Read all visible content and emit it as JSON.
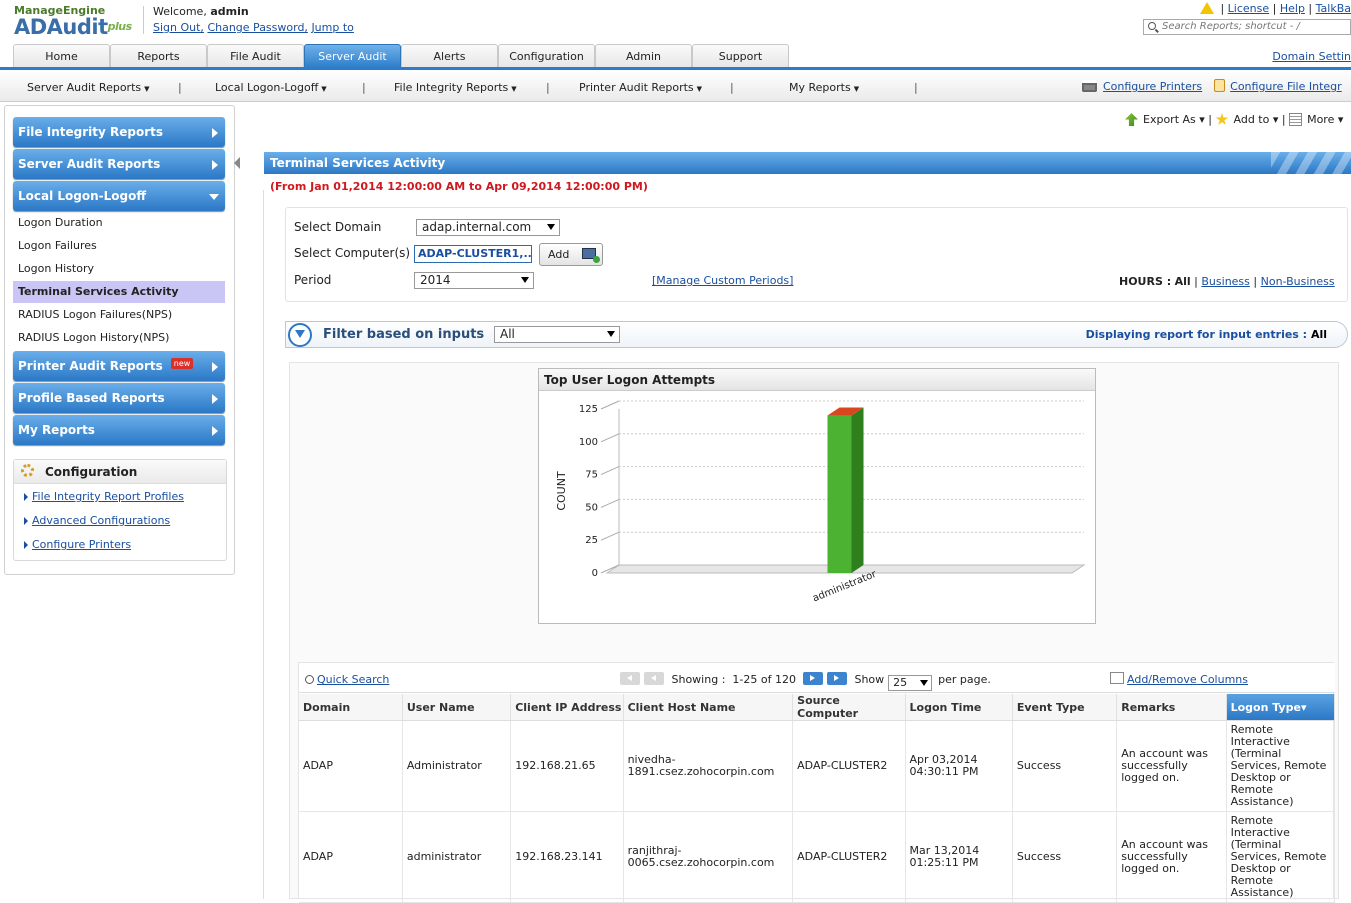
{
  "brand": {
    "manage_engine": "ManageEngine",
    "product": "ADAudit",
    "plus": "plus"
  },
  "header": {
    "welcome": "Welcome,",
    "user": "admin",
    "sign_out": "Sign Out,",
    "change_password": "Change Password,",
    "jump_to": "Jump to",
    "license": "License",
    "help": "Help",
    "talkback": "TalkBa",
    "search_placeholder": "Search Reports; shortcut - /",
    "domain_settings": "Domain Settin"
  },
  "tabs": [
    "Home",
    "Reports",
    "File Audit",
    "Server Audit",
    "Alerts",
    "Configuration",
    "Admin",
    "Support"
  ],
  "active_tab": "Server Audit",
  "subnav": {
    "items": [
      "Server Audit Reports",
      "Local Logon-Logoff",
      "File Integrity Reports",
      "Printer Audit Reports",
      "My Reports"
    ],
    "configure_printers": "Configure Printers",
    "configure_file_integrity": "Configure File Integr"
  },
  "sidebar": {
    "file_integrity": "File Integrity Reports",
    "server_audit": "Server Audit Reports",
    "local_logon": "Local Logon-Logoff",
    "items": [
      "Logon Duration",
      "Logon Failures",
      "Logon History",
      "Terminal Services Activity",
      "RADIUS Logon Failures(NPS)",
      "RADIUS Logon History(NPS)"
    ],
    "printer_audit": "Printer Audit Reports",
    "new_badge": "new",
    "profile_based": "Profile Based Reports",
    "my_reports": "My Reports",
    "config_title": "Configuration",
    "config_links": [
      "File Integrity Report Profiles",
      "Advanced Configurations",
      "Configure Printers"
    ]
  },
  "actions": {
    "export_as": "Export As",
    "add_to": "Add to",
    "more": "More"
  },
  "report": {
    "title": "Terminal Services Activity",
    "date_range": "(From Jan 01,2014 12:00:00 AM to Apr 09,2014 12:00:00 PM)"
  },
  "form": {
    "domain_label": "Select Domain",
    "domain_value": "adap.internal.com",
    "computer_label": "Select Computer(s)",
    "computer_value": "ADAP-CLUSTER1,...",
    "add": "Add",
    "period_label": "Period",
    "period_value": "2014",
    "manage_custom_periods": "[Manage Custom Periods]",
    "hours_label": "HOURS :",
    "hours_all": "All",
    "business": "Business",
    "non_business": "Non-Business"
  },
  "filter": {
    "label": "Filter based on inputs",
    "value": "All",
    "display_info": "Displaying report for input entries :",
    "display_value": "All"
  },
  "chart_data": {
    "type": "bar",
    "title": "Top User Logon Attempts",
    "ylabel": "COUNT",
    "xlabel": "",
    "categories": [
      "administrator"
    ],
    "values": [
      120
    ],
    "ylim": [
      0,
      125
    ],
    "yticks": [
      0,
      25,
      50,
      75,
      100,
      125
    ],
    "grid": true,
    "colors": {
      "bar": "#4cb232",
      "top": "#d9471f"
    }
  },
  "table": {
    "quick_search": "Quick Search",
    "showing_label": "Showing :",
    "showing_value": "1-25 of 120",
    "show_label": "Show",
    "per_page_value": "25",
    "per_page_label": "per page.",
    "add_remove": "Add/Remove Columns",
    "columns": [
      "Domain",
      "User Name",
      "Client IP Address",
      "Client Host Name",
      "Source Computer",
      "Logon Time",
      "Event Type",
      "Remarks",
      "Logon Type"
    ],
    "rows": [
      [
        "ADAP",
        "Administrator",
        "192.168.21.65",
        "nivedha-1891.csez.zohocorpin.com",
        "ADAP-CLUSTER2",
        "Apr 03,2014 04:30:11 PM",
        "Success",
        "An account was successfully logged on.",
        "Remote Interactive (Terminal Services, Remote Desktop or Remote Assistance)"
      ],
      [
        "ADAP",
        "administrator",
        "192.168.23.141",
        "ranjithraj-0065.csez.zohocorpin.com",
        "ADAP-CLUSTER2",
        "Mar 13,2014 01:25:11 PM",
        "Success",
        "An account was successfully logged on.",
        "Remote Interactive (Terminal Services, Remote Desktop or Remote Assistance)"
      ]
    ]
  }
}
